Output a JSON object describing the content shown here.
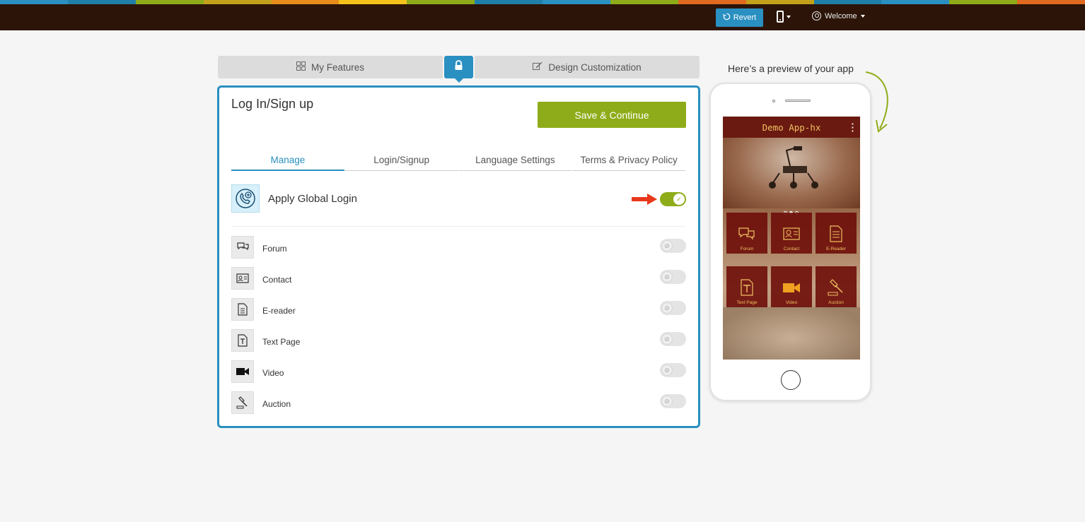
{
  "brand_stripe_colors": [
    "#2b8fc1",
    "#1f7fa8",
    "#8eac19",
    "#c4a11a",
    "#e88c1a",
    "#f5c21b",
    "#8eac19",
    "#1f7fa8",
    "#2a8fc1",
    "#8eac19",
    "#e06a1f",
    "#c4a11a",
    "#1f7fa8",
    "#2a8fc1",
    "#8eac19",
    "#e06a1f"
  ],
  "topbar": {
    "revert_label": "Revert",
    "device_icon": "mobile-phone-icon",
    "welcome_label": "Welcome"
  },
  "top_tabs": {
    "features_label": "My Features",
    "design_label": "Design Customization",
    "lock_icon": "lock-icon"
  },
  "panel": {
    "title": "Log In/Sign up",
    "save_label": "Save & Continue",
    "subtabs": [
      {
        "label": "Manage",
        "active": true
      },
      {
        "label": "Login/Signup",
        "active": false
      },
      {
        "label": "Language Settings",
        "active": false
      },
      {
        "label": "Terms & Privacy Policy",
        "active": false
      }
    ],
    "global_login": {
      "label": "Apply Global Login",
      "enabled": true
    },
    "features": [
      {
        "label": "Forum",
        "icon": "chat-bubbles-icon",
        "enabled": false
      },
      {
        "label": "Contact",
        "icon": "contact-card-icon",
        "enabled": false
      },
      {
        "label": "E-reader",
        "icon": "document-icon",
        "enabled": false
      },
      {
        "label": "Text Page",
        "icon": "text-page-icon",
        "enabled": false
      },
      {
        "label": "Video",
        "icon": "video-camera-icon",
        "enabled": false
      },
      {
        "label": "Auction",
        "icon": "gavel-icon",
        "enabled": false
      }
    ]
  },
  "preview": {
    "title": "Here’s a preview of your app",
    "app_title": "Demo App-hx",
    "tiles": [
      {
        "label": "Forum"
      },
      {
        "label": "Contact"
      },
      {
        "label": "E-Reader"
      },
      {
        "label": "Text Page"
      },
      {
        "label": "Video"
      },
      {
        "label": "Auction"
      }
    ]
  },
  "colors": {
    "accent_blue": "#2a8fc1",
    "accent_green": "#8eac19",
    "topbar_bg": "#2c1408",
    "app_header": "#6a1a10",
    "app_text": "#f0c060",
    "arrow_red": "#e8381c"
  }
}
